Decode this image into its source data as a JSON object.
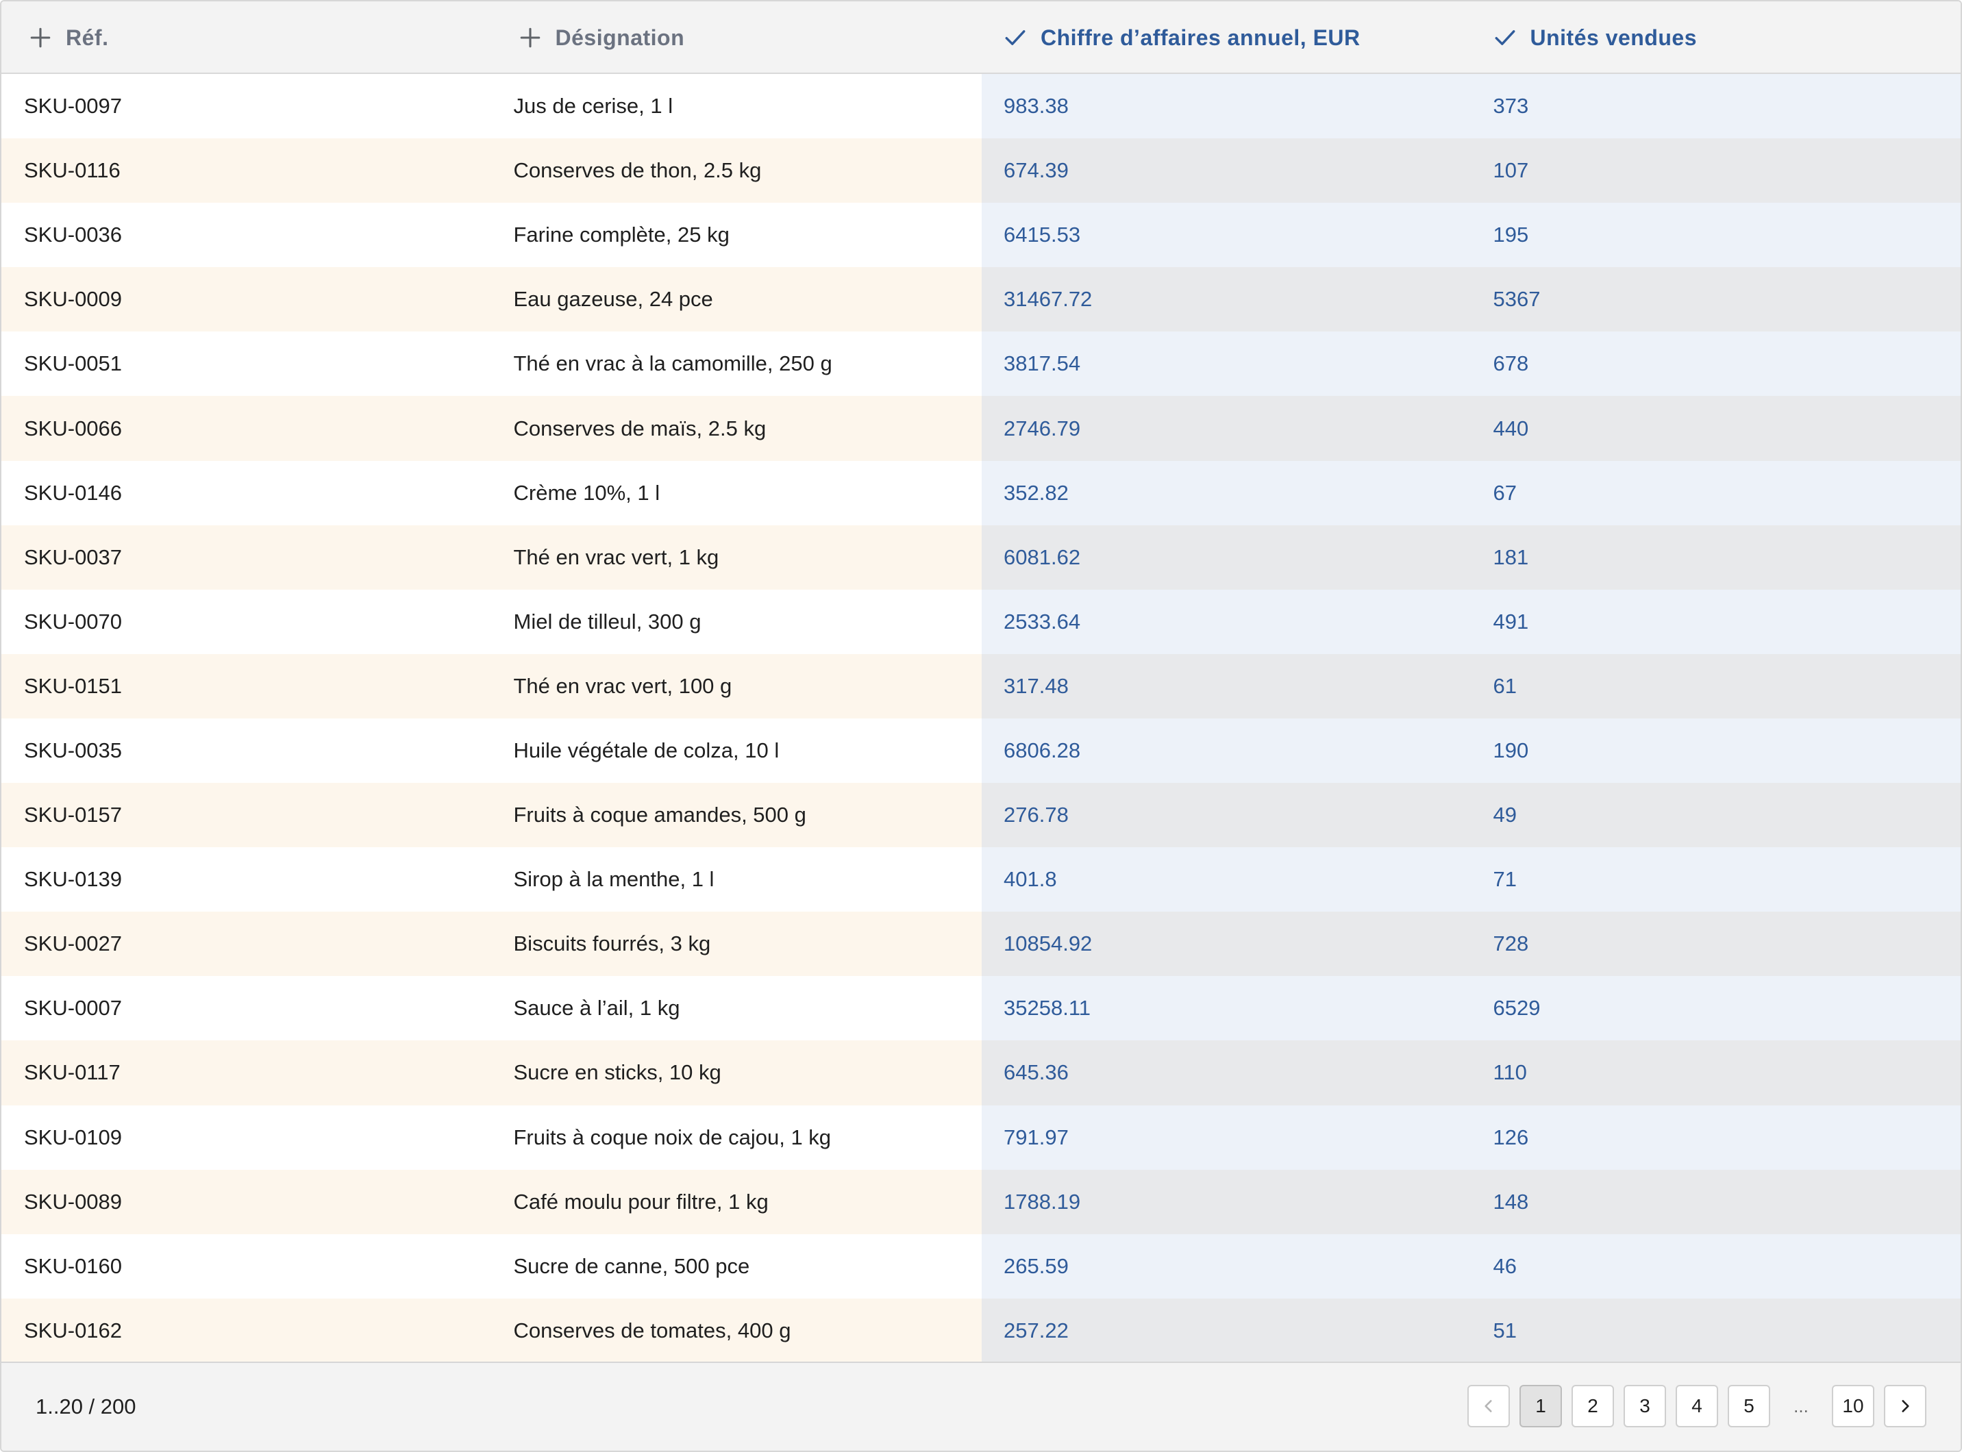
{
  "table": {
    "columns": [
      {
        "label": "Réf.",
        "icon": "plus-icon"
      },
      {
        "label": "Désignation",
        "icon": "plus-icon"
      },
      {
        "label": "Chiffre d’affaires annuel, EUR",
        "icon": "check-icon"
      },
      {
        "label": "Unités vendues",
        "icon": "check-icon"
      }
    ],
    "rows": [
      [
        "SKU-0097",
        "Jus de cerise, 1 l",
        "983.38",
        "373"
      ],
      [
        "SKU-0116",
        "Conserves de thon, 2.5 kg",
        "674.39",
        "107"
      ],
      [
        "SKU-0036",
        "Farine complète, 25 kg",
        "6415.53",
        "195"
      ],
      [
        "SKU-0009",
        "Eau gazeuse, 24 pce",
        "31467.72",
        "5367"
      ],
      [
        "SKU-0051",
        "Thé en vrac à la camomille, 250 g",
        "3817.54",
        "678"
      ],
      [
        "SKU-0066",
        "Conserves de maïs, 2.5 kg",
        "2746.79",
        "440"
      ],
      [
        "SKU-0146",
        "Crème 10%, 1 l",
        "352.82",
        "67"
      ],
      [
        "SKU-0037",
        "Thé en vrac vert, 1 kg",
        "6081.62",
        "181"
      ],
      [
        "SKU-0070",
        "Miel de tilleul, 300 g",
        "2533.64",
        "491"
      ],
      [
        "SKU-0151",
        "Thé en vrac vert, 100 g",
        "317.48",
        "61"
      ],
      [
        "SKU-0035",
        "Huile végétale de colza, 10 l",
        "6806.28",
        "190"
      ],
      [
        "SKU-0157",
        "Fruits à coque amandes, 500 g",
        "276.78",
        "49"
      ],
      [
        "SKU-0139",
        "Sirop à la menthe, 1 l",
        "401.8",
        "71"
      ],
      [
        "SKU-0027",
        "Biscuits fourrés, 3 kg",
        "10854.92",
        "728"
      ],
      [
        "SKU-0007",
        "Sauce à l’ail, 1 kg",
        "35258.11",
        "6529"
      ],
      [
        "SKU-0117",
        "Sucre en sticks, 10 kg",
        "645.36",
        "110"
      ],
      [
        "SKU-0109",
        "Fruits à coque noix de cajou, 1 kg",
        "791.97",
        "126"
      ],
      [
        "SKU-0089",
        "Café moulu pour filtre, 1 kg",
        "1788.19",
        "148"
      ],
      [
        "SKU-0160",
        "Sucre de canne, 500 pce",
        "265.59",
        "46"
      ],
      [
        "SKU-0162",
        "Conserves de tomates, 400 g",
        "257.22",
        "51"
      ]
    ]
  },
  "footer": {
    "range": "1..20 / 200",
    "pages": [
      "1",
      "2",
      "3",
      "4",
      "5"
    ],
    "ellipsis": "...",
    "last_page": "10",
    "current_page": "1"
  },
  "colors": {
    "accent": "#2f5b9a",
    "header_bg": "#f3f3f3",
    "row_alt_warm": "#fdf6ec",
    "row_selected_cool": "#edf2f9"
  }
}
